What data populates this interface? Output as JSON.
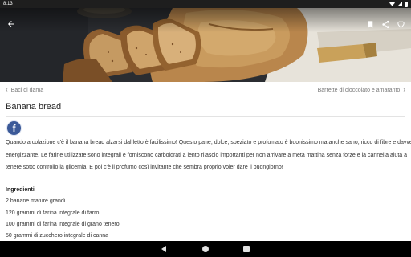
{
  "status_bar": {
    "time": "8:13"
  },
  "toolbar": {
    "back_icon": "arrow-left-icon",
    "bookmark_icon": "bookmark-icon",
    "share_icon": "share-icon",
    "favorite_icon": "heart-outline-icon"
  },
  "navigation": {
    "prev_label": "Baci di dama",
    "next_label": "Barrette di cioccolato e amaranto"
  },
  "recipe": {
    "title": "Banana bread",
    "share_facebook_icon": "facebook-icon",
    "description_lines": [
      "Quando a colazione c'è il banana bread alzarsi dal letto è facilissimo! Questo pane, dolce, speziato e profumato è buonissimo ma anche sano, ricco di fibre e davvero",
      "energizzante. Le farine utilizzate sono integrali e forniscono carboidrati a lento rilascio importanti per non arrivare a metà mattina senza forze e la cannella aiuta a",
      "tenere sotto controllo la glicemia. E poi c'è il profumo così invitante che sembra proprio voler dare il buongiorno!"
    ],
    "ingredients_title": "Ingredienti",
    "ingredients": [
      "2 banane mature grandi",
      "120 grammi di farina integrale di farro",
      "100 grammi di farina integrale di grano tenero",
      "50 grammi di zucchero integrale di canna"
    ]
  },
  "colors": {
    "status_bar": "#1e1e1e",
    "facebook": "#3b5998",
    "nav_bar": "#000000"
  }
}
